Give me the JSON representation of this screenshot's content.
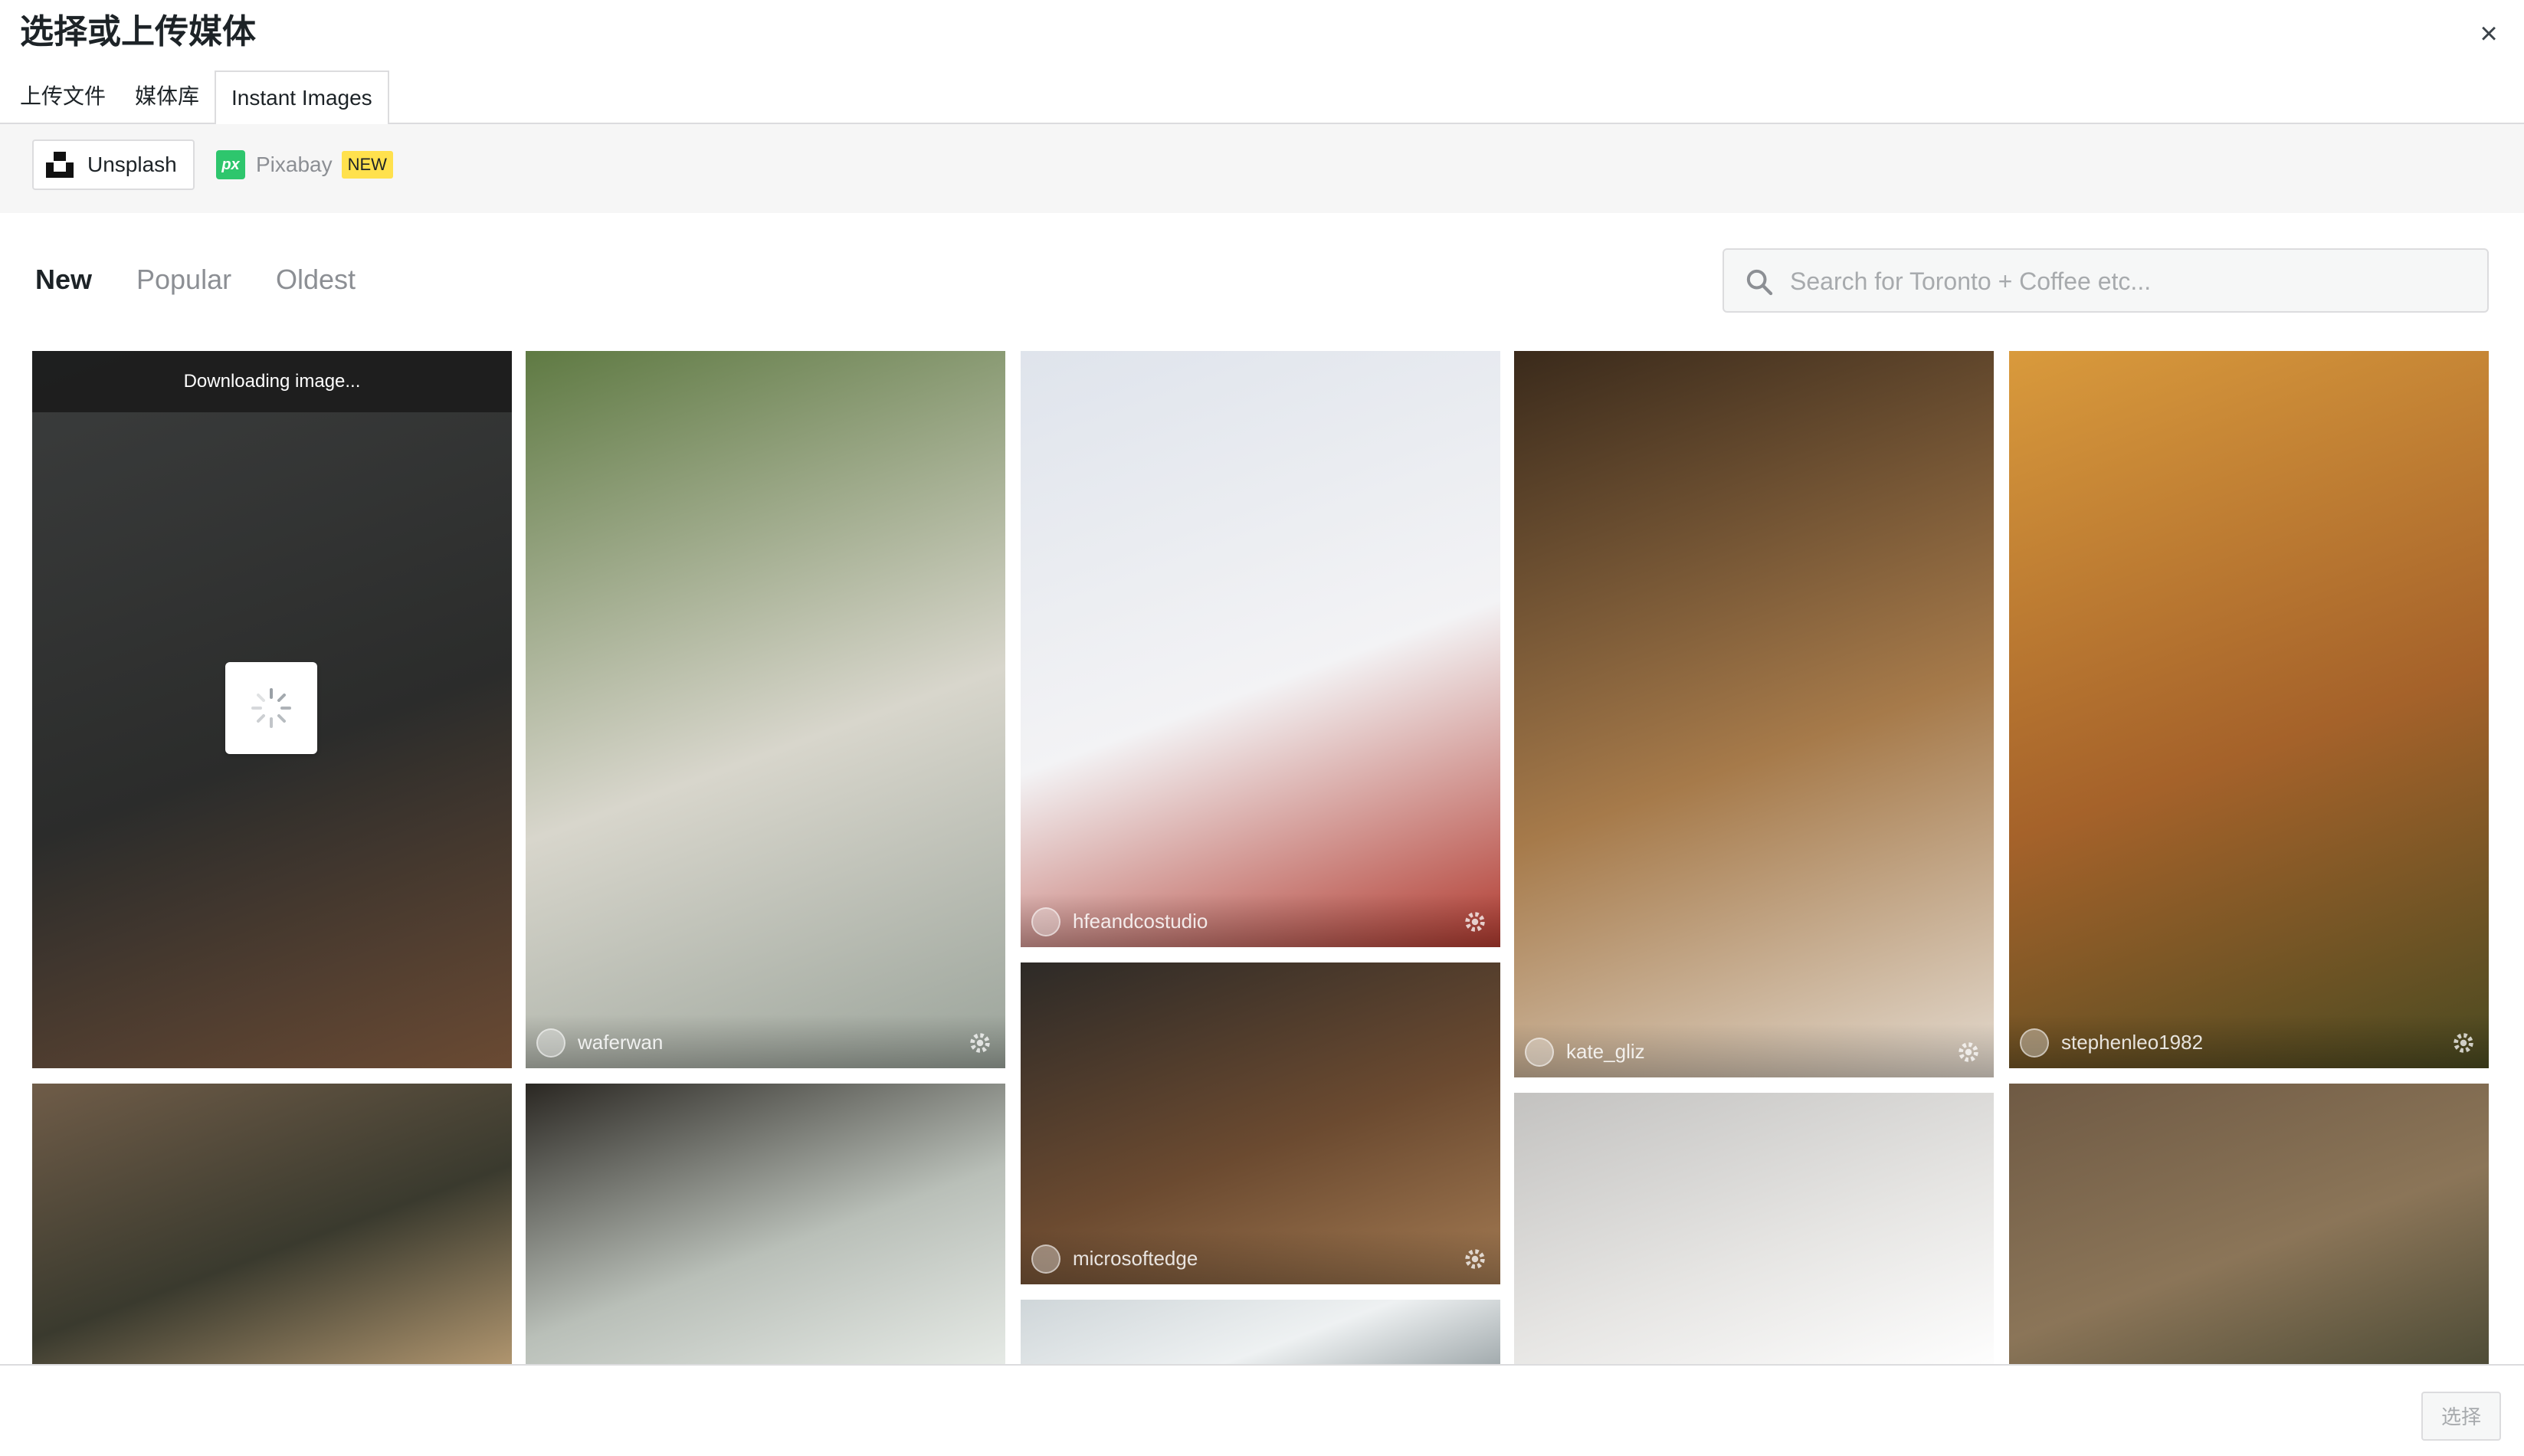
{
  "modal": {
    "title": "选择或上传媒体",
    "close_icon": "×"
  },
  "router": {
    "tabs": [
      {
        "label": "上传文件",
        "active": false
      },
      {
        "label": "媒体库",
        "active": false
      },
      {
        "label": "Instant Images",
        "active": true
      }
    ]
  },
  "providers": [
    {
      "label": "Unsplash",
      "icon": "unsplash-logo-icon",
      "active": true
    },
    {
      "label": "Pixabay",
      "icon": "pixabay-logo-icon",
      "icon_text": "px",
      "badge": "NEW",
      "active": false
    }
  ],
  "filters": [
    {
      "label": "New",
      "active": true
    },
    {
      "label": "Popular",
      "active": false
    },
    {
      "label": "Oldest",
      "active": false
    }
  ],
  "search": {
    "placeholder": "Search for Toronto + Coffee etc...",
    "value": ""
  },
  "photos": [
    {
      "user": "",
      "status": "Downloading image...",
      "colors": [
        "#3b3d3d",
        "#2b2c2b",
        "#6a4a33"
      ]
    },
    {
      "user": "waferwan",
      "colors": [
        "#5f7a43",
        "#d8d6cc",
        "#9aa39a"
      ]
    },
    {
      "user": "hfeandcostudio",
      "colors": [
        "#dfe4ec",
        "#f3f3f5",
        "#b13a2f"
      ]
    },
    {
      "user": "kate_gliz",
      "colors": [
        "#3a2a1b",
        "#a67a4a",
        "#e4dbd0"
      ]
    },
    {
      "user": "stephenleo1982",
      "colors": [
        "#d99a3c",
        "#a5622a",
        "#4a4a21"
      ]
    },
    {
      "user": "microsoftedge",
      "colors": [
        "#2d2a27",
        "#6b4a30",
        "#a37a52"
      ]
    },
    {
      "user": "",
      "colors": [
        "#6f5c48",
        "#3a3a2e",
        "#b69a72"
      ]
    },
    {
      "user": "",
      "colors": [
        "#2a2722",
        "#b9bfb8",
        "#e8ece8"
      ]
    },
    {
      "user": "",
      "colors": [
        "#cfd6d9",
        "#eef1f2",
        "#9aa3a6"
      ]
    },
    {
      "user": "",
      "colors": [
        "#c3c2c0",
        "#e6e5e3",
        "#ffffff"
      ]
    },
    {
      "user": "",
      "colors": [
        "#6f5a44",
        "#8b7558",
        "#4b4a35"
      ]
    }
  ],
  "footer": {
    "select_label": "选择"
  }
}
